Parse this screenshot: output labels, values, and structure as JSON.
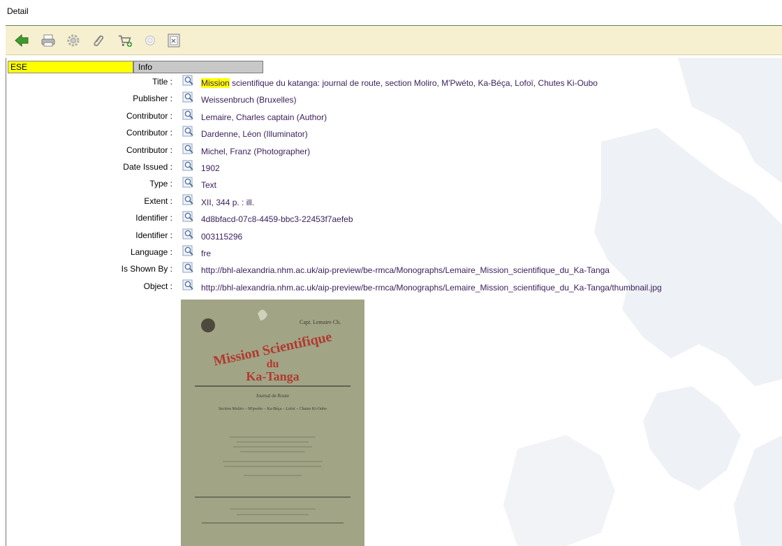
{
  "header": {
    "title": "Detail"
  },
  "toolbar": {
    "buttons": [
      {
        "name": "back-button",
        "icon": "green-back-arrow-icon"
      },
      {
        "name": "print-button",
        "icon": "printer-icon"
      },
      {
        "name": "settings-button",
        "icon": "gear-icon"
      },
      {
        "name": "attach-button",
        "icon": "paperclip-icon"
      },
      {
        "name": "add-to-cart-button",
        "icon": "cart-add-icon"
      },
      {
        "name": "disabled-button",
        "icon": "circle-icon"
      },
      {
        "name": "preview-button",
        "icon": "document-icon"
      }
    ]
  },
  "tabs": {
    "ese": "ESE",
    "info": "Info"
  },
  "fields": [
    {
      "label": "Title :",
      "value_pre": "",
      "value_hl": "Mission",
      "value": " scientifique du katanga: journal de route, section Moliro, M'Pwéto, Ka-Béça, Lofoï, Chutes Ki-Oubo"
    },
    {
      "label": "Publisher :",
      "value": "Weissenbruch (Bruxelles)"
    },
    {
      "label": "Contributor :",
      "value": "Lemaire, Charles captain (Author)"
    },
    {
      "label": "Contributor :",
      "value": "Dardenne, Léon (Illuminator)"
    },
    {
      "label": "Contributor :",
      "value": "Michel, Franz (Photographer)"
    },
    {
      "label": "Date Issued :",
      "value": "1902"
    },
    {
      "label": "Type :",
      "value": "Text"
    },
    {
      "label": "Extent :",
      "value": "XII, 344 p. : ill."
    },
    {
      "label": "Identifier :",
      "value": "4d8bfacd-07c8-4459-bbc3-22453f7aefeb"
    },
    {
      "label": "Identifier :",
      "value": "003115296"
    },
    {
      "label": "Language :",
      "value": "fre"
    },
    {
      "label": "Is Shown By :",
      "value": "http://bhl-alexandria.nhm.ac.uk/aip-preview/be-rmca/Monographs/Lemaire_Mission_scientifique_du_Ka-Tanga"
    },
    {
      "label": "Object :",
      "value": "http://bhl-alexandria.nhm.ac.uk/aip-preview/be-rmca/Monographs/Lemaire_Mission_scientifique_du_Ka-Tanga/thumbnail.jpg"
    }
  ],
  "thumbnail": {
    "author_line": "Capt. Lemaire Ch.",
    "title_line1": "Mission Scientifique",
    "title_line2": "du",
    "title_line3": "Ka-Tanga",
    "subtitle": "Journal de Route",
    "sections": "Section Moliro – M'pwéto – Ka-Béça – Lofoï – Chutes Ki-Oubo",
    "colors": {
      "paper": "#a2a486",
      "title": "#b03a2e",
      "ink": "#3e3a30"
    }
  },
  "colors": {
    "highlight": "#ffff00",
    "toolbar_bg": "#f6f0d0",
    "tab_info_bg": "#c8c8c8",
    "value_text": "#3a1e5a"
  }
}
